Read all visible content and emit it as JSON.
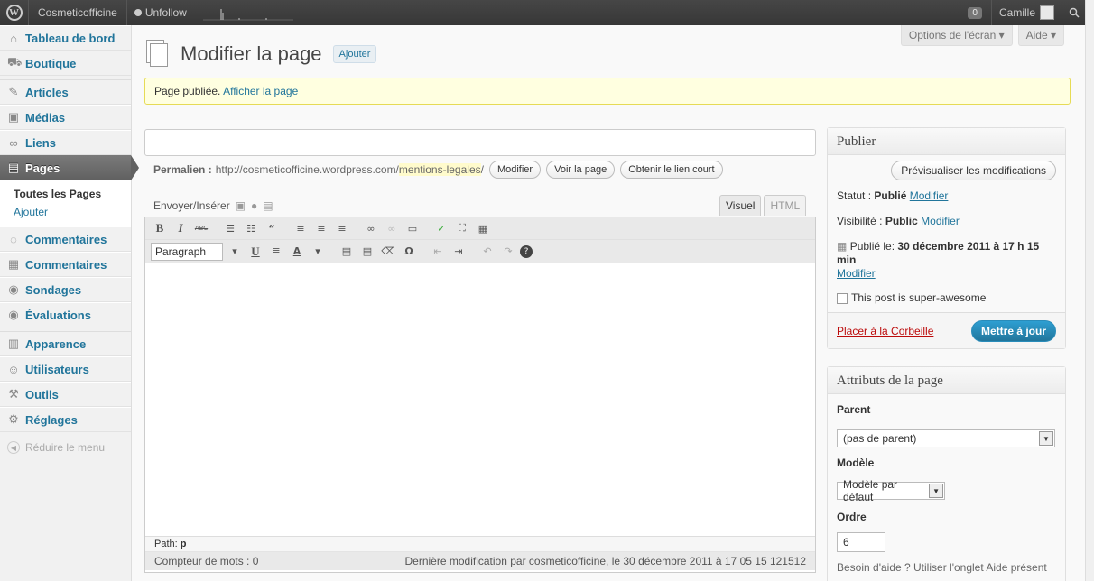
{
  "adminbar": {
    "wp_logo": "W",
    "site_name": "Cosmeticofficine",
    "unfollow": "Unfollow",
    "comment_count": "0",
    "user": "Camille"
  },
  "screen_meta": {
    "options": "Options de l'écran",
    "help": "Aide"
  },
  "menu": {
    "items": [
      {
        "label": "Tableau de bord",
        "icon": "dashboard-icon"
      },
      {
        "label": "Boutique",
        "icon": "cart-icon"
      },
      {
        "label": "Articles",
        "icon": "pin-icon"
      },
      {
        "label": "Médias",
        "icon": "media-icon"
      },
      {
        "label": "Liens",
        "icon": "link-icon"
      },
      {
        "label": "Pages",
        "icon": "pages-icon"
      },
      {
        "label": "Commentaires",
        "icon": "comment-icon"
      },
      {
        "label": "Commentaires",
        "icon": "comments-icon"
      },
      {
        "label": "Sondages",
        "icon": "poll-icon"
      },
      {
        "label": "Évaluations",
        "icon": "rating-icon"
      },
      {
        "label": "Apparence",
        "icon": "appearance-icon"
      },
      {
        "label": "Utilisateurs",
        "icon": "users-icon"
      },
      {
        "label": "Outils",
        "icon": "tools-icon"
      },
      {
        "label": "Réglages",
        "icon": "settings-icon"
      }
    ],
    "sub": {
      "all_pages": "Toutes les Pages",
      "add": "Ajouter"
    },
    "collapse": "Réduire le menu"
  },
  "page": {
    "title": "Modifier la page",
    "add_button": "Ajouter",
    "notice_text": "Page publiée.",
    "notice_link": "Afficher la page"
  },
  "permalink": {
    "label": "Permalien :",
    "base": "http://cosmeticofficine.wordpress.com/",
    "slug": "mentions-legales",
    "trail": "/",
    "edit": "Modifier",
    "view": "Voir la page",
    "shortlink": "Obtenir le lien court"
  },
  "editor": {
    "upload_label": "Envoyer/Insérer",
    "tab_visual": "Visuel",
    "tab_html": "HTML",
    "format": "Paragraph",
    "path_label": "Path:",
    "path_value": "p",
    "word_count": "Compteur de mots : 0",
    "last_edit": "Dernière modification par cosmeticofficine, le 30 décembre 2011 à 17 05 15 121512"
  },
  "publish": {
    "title": "Publier",
    "preview": "Prévisualiser les modifications",
    "status_label": "Statut :",
    "status_value": "Publié",
    "visibility_label": "Visibilité :",
    "visibility_value": "Public",
    "edit": "Modifier",
    "published_label": "Publié le:",
    "published_value": "30 décembre 2011 à 17 h 15 min",
    "awesome": "This post is super-awesome",
    "trash": "Placer à la Corbeille",
    "update": "Mettre à jour"
  },
  "attributes": {
    "title": "Attributs de la page",
    "parent_label": "Parent",
    "parent_value": "(pas de parent)",
    "template_label": "Modèle",
    "template_value": "Modèle par défaut",
    "order_label": "Ordre",
    "order_value": "6",
    "help": "Besoin d'aide ? Utiliser l'onglet Aide présent"
  },
  "colors": {
    "accent": "#21759b",
    "adminbar": "#464646",
    "update": "#2e9fd2",
    "notice": "#ffffe0"
  }
}
